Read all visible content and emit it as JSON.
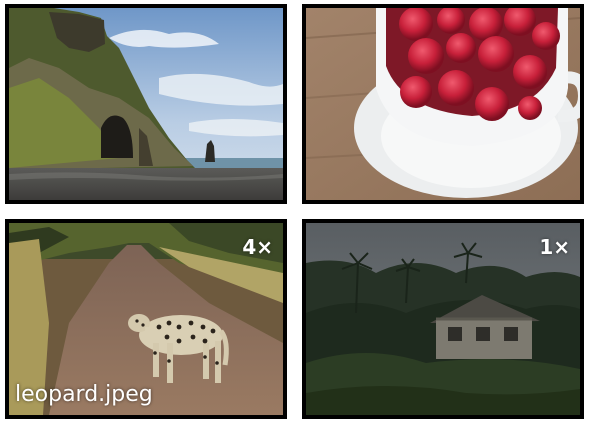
{
  "gallery": {
    "tiles": [
      {
        "subject": "sea-cliff-beach-photo",
        "badge": "",
        "caption": ""
      },
      {
        "subject": "raspberries-cup-photo",
        "badge": "",
        "caption": ""
      },
      {
        "subject": "leopard-photo",
        "badge": "4×",
        "caption": "leopard.jpeg"
      },
      {
        "subject": "jungle-house-photo",
        "badge": "1×",
        "caption": ""
      }
    ]
  },
  "colors": {
    "border": "#000000",
    "overlay_text": "#ffffff"
  }
}
